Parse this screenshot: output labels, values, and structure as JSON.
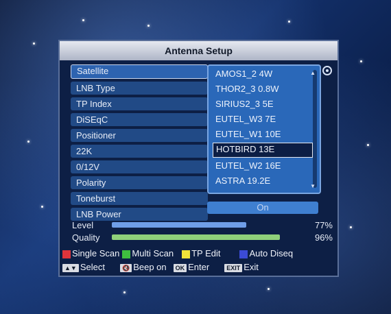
{
  "window": {
    "title": "Antenna Setup"
  },
  "menu": {
    "items": [
      {
        "label": "Satellite"
      },
      {
        "label": "LNB Type"
      },
      {
        "label": "TP Index"
      },
      {
        "label": "DiSEqC"
      },
      {
        "label": "Positioner"
      },
      {
        "label": "22K"
      },
      {
        "label": "0/12V"
      },
      {
        "label": "Polarity"
      },
      {
        "label": "Toneburst"
      },
      {
        "label": "LNB Power"
      }
    ]
  },
  "satellite_list": {
    "items": [
      {
        "label": "AMOS1_2 4W"
      },
      {
        "label": "THOR2_3 0.8W"
      },
      {
        "label": "SIRIUS2_3 5E"
      },
      {
        "label": "EUTEL_W3 7E"
      },
      {
        "label": "EUTEL_W1 10E"
      },
      {
        "label": "HOTBIRD 13E"
      },
      {
        "label": "EUTEL_W2 16E"
      },
      {
        "label": "ASTRA 19.2E"
      }
    ],
    "selected": "HOTBIRD 13E"
  },
  "lnb_power": {
    "value": "On"
  },
  "signal": {
    "level": {
      "label": "Level",
      "percent": 77,
      "display": "77%",
      "color": "#6f9ee8"
    },
    "quality": {
      "label": "Quality",
      "percent": 96,
      "display": "96%",
      "color": "#8fd07a"
    }
  },
  "footer": {
    "row1": [
      {
        "color": "#e0343b",
        "label": "Single Scan"
      },
      {
        "color": "#3fbe3f",
        "label": "Multi Scan"
      },
      {
        "color": "#f0e23a",
        "label": "TP Edit"
      },
      {
        "color": "#3b4bd6",
        "label": "Auto Diseq"
      }
    ],
    "row2": [
      {
        "key": "▲▼",
        "label": "Select"
      },
      {
        "key": "🔇",
        "label": "Beep on"
      },
      {
        "key": "OK",
        "label": "Enter"
      },
      {
        "key": "EXIT",
        "label": "Exit"
      }
    ]
  }
}
